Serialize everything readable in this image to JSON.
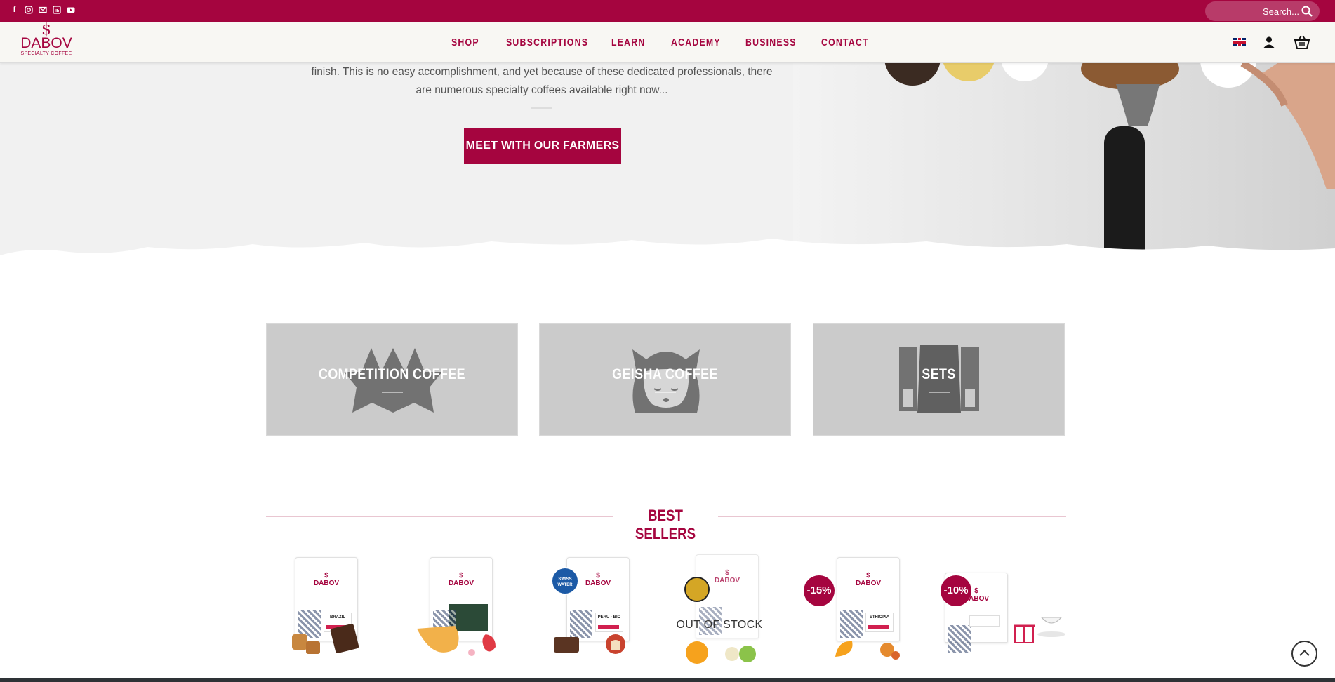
{
  "topbar": {
    "social_icons": [
      "facebook-icon",
      "instagram-icon",
      "email-icon",
      "linkedin-icon",
      "youtube-icon"
    ],
    "search_placeholder": "Search..."
  },
  "header": {
    "logo": {
      "name": "DABOV",
      "sub": "SPECIALTY COFFEE"
    },
    "nav": [
      "SHOP",
      "SUBSCRIPTIONS",
      "LEARN",
      "ACADEMY",
      "BUSINESS",
      "CONTACT"
    ]
  },
  "hero": {
    "line1": "finish. This is no easy accomplishment, and yet because of these dedicated professionals, there",
    "line2": "are numerous specialty coffees available right now...",
    "cta": "MEET WITH OUR FARMERS"
  },
  "categories": [
    {
      "title": "COMPETITION COFFEE",
      "icon": "crown-icon"
    },
    {
      "title": "GEISHA COFFEE",
      "icon": "geisha-icon"
    },
    {
      "title": "SETS",
      "icon": "sets-icon"
    }
  ],
  "best_sellers": {
    "title": "BEST SELLERS",
    "products": [
      {
        "bag_text": "BRAZIL",
        "badge": "",
        "out_of_stock": ""
      },
      {
        "bag_text": "",
        "badge": "",
        "out_of_stock": ""
      },
      {
        "bag_text": "PERU - BIO",
        "badge": "SWISS WATER",
        "out_of_stock": ""
      },
      {
        "bag_text": "",
        "badge": "",
        "out_of_stock": "OUT OF STOCK"
      },
      {
        "bag_text": "ETHIOPIA",
        "badge": "-15%",
        "out_of_stock": ""
      },
      {
        "bag_text": "",
        "badge": "-10%",
        "out_of_stock": ""
      }
    ]
  },
  "colors": {
    "brand": "#a5053f",
    "category_bg": "#cbcbcb",
    "hero_bg": "#f1f1f1"
  }
}
